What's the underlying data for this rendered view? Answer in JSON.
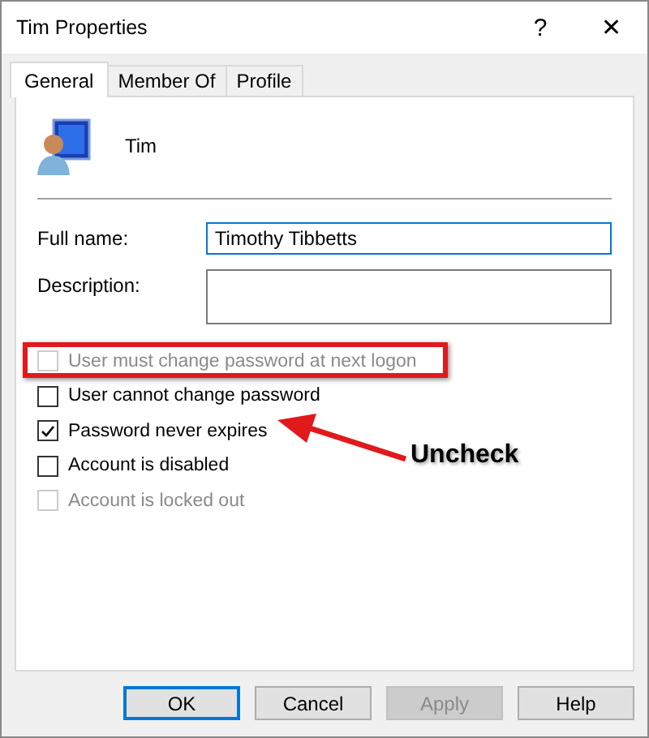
{
  "window": {
    "title": "Tim Properties",
    "help": "?",
    "close": "✕"
  },
  "tabs": [
    {
      "label": "General",
      "selected": true
    },
    {
      "label": "Member Of",
      "selected": false
    },
    {
      "label": "Profile",
      "selected": false
    }
  ],
  "user": {
    "name": "Tim"
  },
  "fields": [
    {
      "kind": "single",
      "label": "Full name:",
      "value": "Timothy Tibbetts",
      "focused": true
    },
    {
      "kind": "multi",
      "label": "Description:",
      "focused": false
    }
  ],
  "checkboxes": [
    {
      "label": "User must change password at next logon",
      "checked": false,
      "disabled": true,
      "highlighted": true
    },
    {
      "label": "User cannot change password",
      "checked": false,
      "disabled": false,
      "highlighted": false
    },
    {
      "label": "Password never expires",
      "checked": true,
      "disabled": false,
      "highlighted": false
    },
    {
      "label": "Account is disabled",
      "checked": false,
      "disabled": false,
      "highlighted": false
    },
    {
      "label": "Account is locked out",
      "checked": false,
      "disabled": true,
      "highlighted": false
    }
  ],
  "annotation": {
    "text": "Uncheck"
  },
  "buttons": [
    {
      "label": "OK",
      "default": true,
      "disabled": false
    },
    {
      "label": "Cancel",
      "default": false,
      "disabled": false
    },
    {
      "label": "Apply",
      "default": false,
      "disabled": true
    },
    {
      "label": "Help",
      "default": false,
      "disabled": false
    }
  ]
}
